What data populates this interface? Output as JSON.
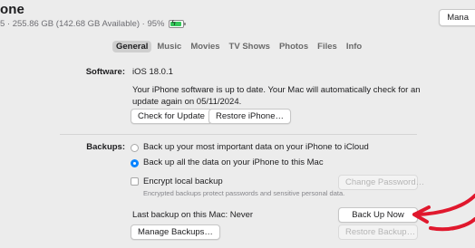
{
  "header": {
    "device_name": "one",
    "device_info": "5 · 255.86 GB (142.68 GB Available) · 95%",
    "battery_level": 0.95,
    "battery_color": "#34c759",
    "manage_label": "Mana"
  },
  "tabs": [
    {
      "label": "General",
      "selected": true
    },
    {
      "label": "Music"
    },
    {
      "label": "Movies"
    },
    {
      "label": "TV Shows"
    },
    {
      "label": "Photos"
    },
    {
      "label": "Files"
    },
    {
      "label": "Info"
    }
  ],
  "software": {
    "label": "Software:",
    "version": "iOS 18.0.1",
    "status_line1": "Your iPhone software is up to date. Your Mac will automatically check for an",
    "status_line2": "update again on 05/11/2024.",
    "check_update_label": "Check for Update",
    "restore_label": "Restore iPhone…"
  },
  "backups": {
    "label": "Backups:",
    "option_icloud": "Back up your most important data on your iPhone to iCloud",
    "option_mac": "Back up all the data on your iPhone to this Mac",
    "selected_option": "mac",
    "encrypt_label": "Encrypt local backup",
    "encrypt_note": "Encrypted backups protect passwords and sensitive personal data.",
    "change_password_label": "Change Password…",
    "last_backup_text": "Last backup on this Mac: Never",
    "back_up_now_label": "Back Up Now",
    "manage_backups_label": "Manage Backups…",
    "restore_backup_label": "Restore Backup…"
  },
  "annotation": {
    "color": "#e0182d"
  }
}
